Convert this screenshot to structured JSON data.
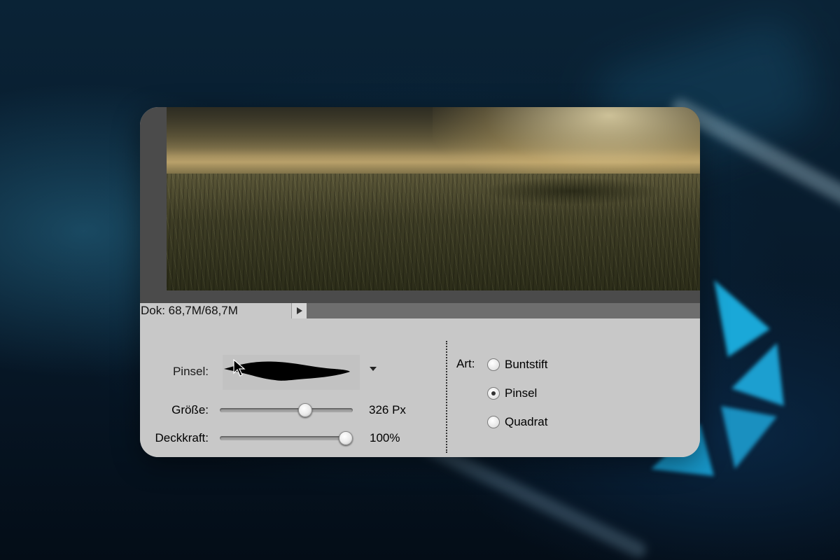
{
  "status": {
    "doc_size": "Dok: 68,7M/68,7M"
  },
  "options": {
    "brush_label": "Pinsel:",
    "size": {
      "label": "Größe:",
      "value_text": "326 Px",
      "level_fraction": 0.66
    },
    "opacity": {
      "label": "Deckkraft:",
      "value_text": "100%",
      "level_fraction": 1.0
    },
    "mode": {
      "label": "Art:",
      "choices": [
        {
          "label": "Buntstift",
          "selected": false
        },
        {
          "label": "Pinsel",
          "selected": true
        },
        {
          "label": "Quadrat",
          "selected": false
        }
      ]
    }
  },
  "icons": {
    "status_arrow": "triangle-right-icon",
    "brush_dropdown": "chevron-down-icon",
    "cursor": "arrow-cursor-icon"
  }
}
